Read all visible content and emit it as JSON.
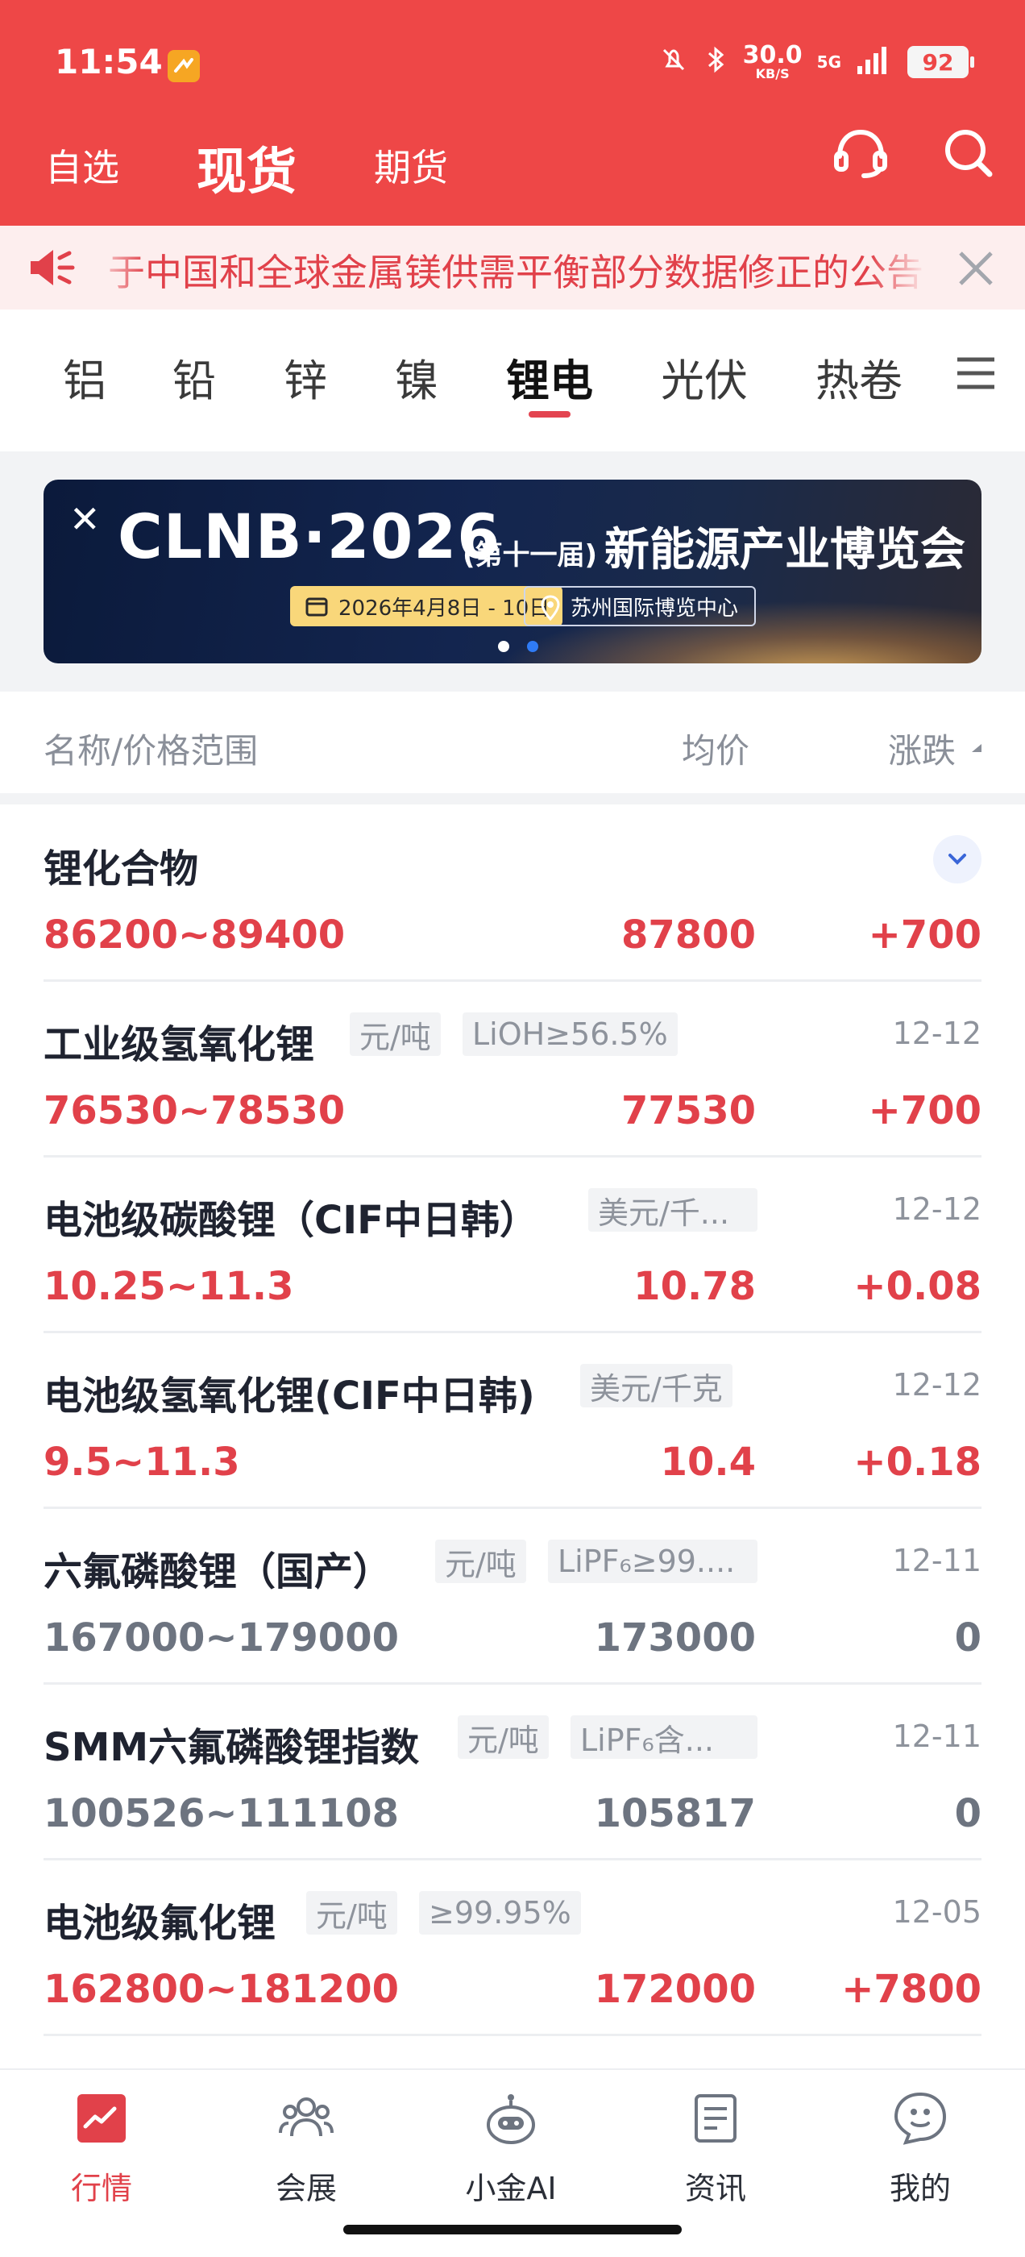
{
  "status": {
    "time": "11:54",
    "speed_value": "30.0",
    "speed_unit": "KB/S",
    "network": "5G",
    "battery": "92"
  },
  "header": {
    "tabs": [
      {
        "label": "自选",
        "active": false
      },
      {
        "label": "现货",
        "active": true
      },
      {
        "label": "期货",
        "active": false
      }
    ],
    "icons": [
      "headset-icon",
      "search-icon"
    ]
  },
  "ticker": {
    "text": "于中国和全球金属镁供需平衡部分数据修正的公告"
  },
  "categories": {
    "items": [
      "铝",
      "铅",
      "锌",
      "镍",
      "锂电",
      "光伏",
      "热卷"
    ],
    "active": "锂电"
  },
  "banner": {
    "title": "CLNB·2026",
    "edition": "(第十一届)",
    "subtitle": "新能源产业博览会",
    "date": "2026年4月8日 - 10日",
    "venue": "苏州国际博览中心"
  },
  "columns": {
    "name": "名称/价格范围",
    "avg": "均价",
    "change": "涨跌"
  },
  "rows": [
    {
      "name": "锂化合物",
      "tags": [],
      "date": "",
      "range": "86200~89400",
      "avg": "87800",
      "change": "+700",
      "status": "up"
    },
    {
      "name": "工业级氢氧化锂",
      "tags": [
        "元/吨",
        "LiOH≥56.5%"
      ],
      "date": "12-12",
      "range": "76530~78530",
      "avg": "77530",
      "change": "+700",
      "status": "up"
    },
    {
      "name": "电池级碳酸锂（CIF中日韩）",
      "tags": [
        "美元/千..."
      ],
      "date": "12-12",
      "range": "10.25~11.3",
      "avg": "10.78",
      "change": "+0.08",
      "status": "up"
    },
    {
      "name": "电池级氢氧化锂(CIF中日韩)",
      "tags": [
        "美元/千克"
      ],
      "date": "12-12",
      "range": "9.5~11.3",
      "avg": "10.4",
      "change": "+0.18",
      "status": "up"
    },
    {
      "name": "六氟磷酸锂（国产）",
      "tags": [
        "元/吨",
        "LiPF₆≥99...."
      ],
      "date": "12-11",
      "range": "167000~179000",
      "avg": "173000",
      "change": "0",
      "status": "flat"
    },
    {
      "name": "SMM六氟磷酸锂指数",
      "tags": [
        "元/吨",
        "LiPF₆含..."
      ],
      "date": "12-11",
      "range": "100526~111108",
      "avg": "105817",
      "change": "0",
      "status": "flat"
    },
    {
      "name": "电池级氟化锂",
      "tags": [
        "元/吨",
        "≥99.95%"
      ],
      "date": "12-05",
      "range": "162800~181200",
      "avg": "172000",
      "change": "+7800",
      "status": "up"
    }
  ],
  "bottom_nav": [
    {
      "label": "行情",
      "icon": "market-chart-icon",
      "active": true
    },
    {
      "label": "会展",
      "icon": "people-icon",
      "active": false
    },
    {
      "label": "小金AI",
      "icon": "robot-icon",
      "active": false
    },
    {
      "label": "资讯",
      "icon": "news-icon",
      "active": false
    },
    {
      "label": "我的",
      "icon": "profile-icon",
      "active": false
    }
  ],
  "colors": {
    "brand_red": "#ee4747",
    "up_red": "#e1414a",
    "flat_gray": "#6d7480"
  }
}
